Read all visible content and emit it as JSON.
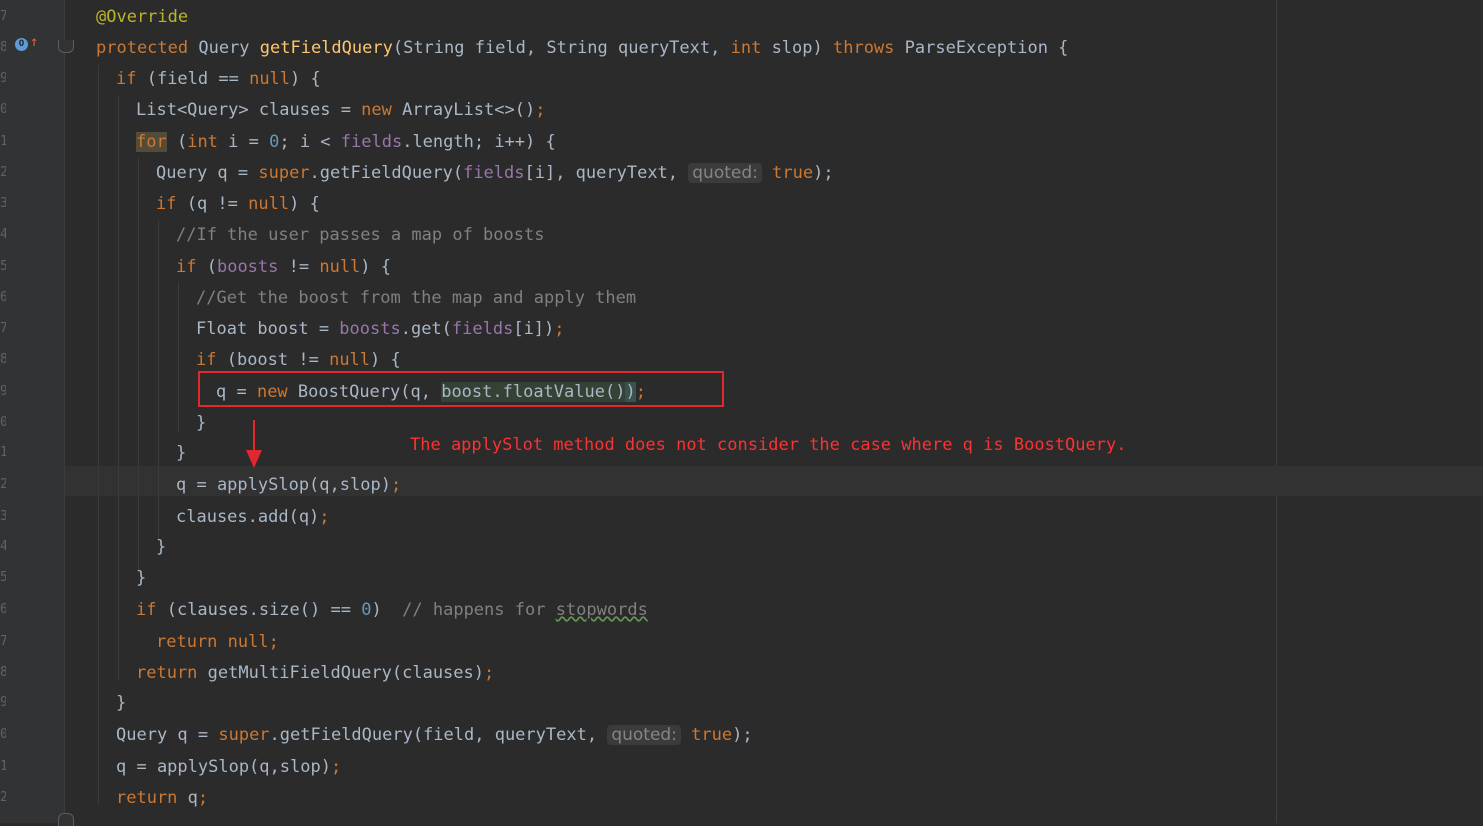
{
  "gutter": {
    "line_digits": [
      "7",
      "8",
      "9",
      "0",
      "1",
      "2",
      "3",
      "4",
      "5",
      "6",
      "7",
      "8",
      "9",
      "0",
      "1",
      "2",
      "3",
      "4",
      "5",
      "6",
      "7",
      "8",
      "9",
      "0",
      "1",
      "2"
    ]
  },
  "code": {
    "annotation": "@Override",
    "method_sig": {
      "protected": "protected",
      "ret_type": " Query ",
      "name": "getFieldQuery",
      "params_a": "(String field, String queryText, ",
      "int": "int",
      "params_b": " slop) ",
      "throws": "throws",
      "exc": " ParseException {"
    },
    "if_field_null": {
      "kw": "if",
      "a": " (field == ",
      "null": "null",
      "b": ") {"
    },
    "clauses_decl": {
      "a": "List<Query> clauses = ",
      "new": "new",
      "b": " ArrayList<>()",
      "semi": ";"
    },
    "for_loop": {
      "kw": "for",
      "a": " (",
      "int": "int",
      "b": " i = ",
      "zero": "0",
      "c": "; i < ",
      "fields": "fields",
      "d": ".length; i++) {"
    },
    "q_super": {
      "a": "Query q = ",
      "super": "super",
      "b": ".getFieldQuery(",
      "fields": "fields",
      "c": "[i], queryText, ",
      "hint": "quoted:",
      "true": "true",
      "d": ");"
    },
    "if_q_null": {
      "kw": "if",
      "a": " (q != ",
      "null": "null",
      "b": ") {"
    },
    "comment1": "//If the user passes a map of boosts",
    "if_boosts": {
      "kw": "if",
      "a": " (",
      "boosts": "boosts",
      "b": " != ",
      "null": "null",
      "c": ") {"
    },
    "comment2": "//Get the boost from the map and apply them",
    "float_boost": {
      "a": "Float boost = ",
      "boosts": "boosts",
      "b": ".get(",
      "fields": "fields",
      "c": "[i])",
      "semi": ";"
    },
    "if_boost": {
      "kw": "if",
      "a": " (boost != ",
      "null": "null",
      "b": ") {"
    },
    "boost_query": {
      "a": "q = ",
      "new": "new",
      "b": " BoostQuery(q, ",
      "hl": "boost.floatValue()",
      "c": ")",
      "semi": ";"
    },
    "close1": "}",
    "close2": "}",
    "apply_slop": {
      "a": "q = applySlop(q,slop)",
      "semi": ";"
    },
    "clauses_add": {
      "a": "clauses.add(q)",
      "semi": ";"
    },
    "close3": "}",
    "close4": "}",
    "if_size": {
      "kw": "if",
      "a": " (clauses.size() == ",
      "zero": "0",
      "b": ")  ",
      "cmt": "// happens for ",
      "stop": "stopwords"
    },
    "return_null": {
      "kw": "return",
      "null": " null",
      "semi": ";"
    },
    "return_multi": {
      "kw": "return",
      "a": " getMultiFieldQuery(clauses)",
      "semi": ";"
    },
    "close5": "}",
    "q_super2": {
      "a": "Query q = ",
      "super": "super",
      "b": ".getFieldQuery(field, queryText, ",
      "hint": "quoted:",
      "true": "true",
      "d": ");"
    },
    "apply_slop2": {
      "a": "q = applySlop(q,slop)",
      "semi": ";"
    },
    "return_q": {
      "kw": "return",
      "a": " q",
      "semi": ";"
    }
  },
  "annotation_note": "The applySlot method does not consider the case where q is BoostQuery.",
  "colors": {
    "keyword": "#cc7832",
    "annotation": "#bbb529",
    "method": "#ffc66d",
    "number": "#6897bb",
    "field": "#9876aa",
    "comment": "#808080",
    "red": "#e0282e"
  }
}
